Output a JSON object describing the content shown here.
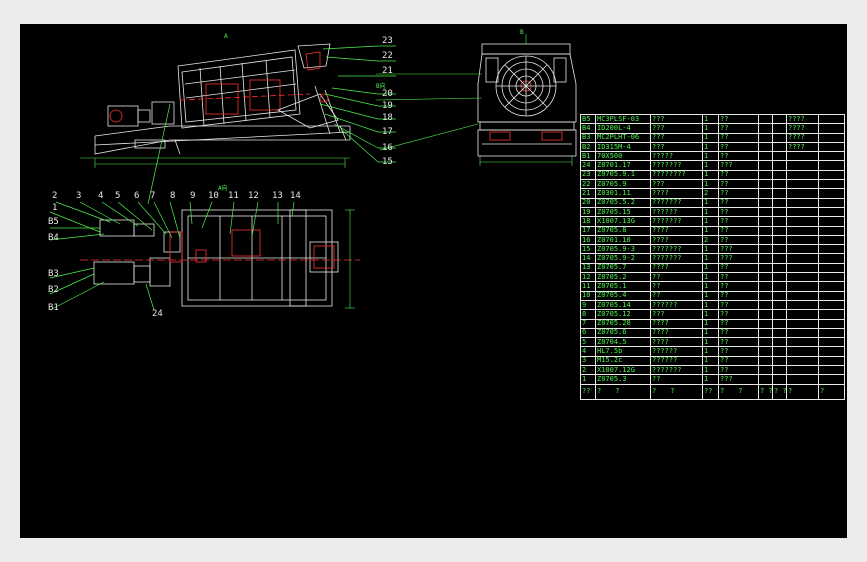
{
  "drawing": {
    "side_view_labels": [
      "23",
      "22",
      "21",
      "20",
      "19",
      "18",
      "17",
      "16",
      "15"
    ],
    "top_view_labels": [
      "2",
      "3",
      "4",
      "5",
      "6",
      "7",
      "8",
      "9",
      "10",
      "11",
      "12",
      "13",
      "14"
    ],
    "left_labels": [
      "1",
      "B5",
      "B4",
      "B3",
      "B2",
      "B1"
    ],
    "bottom_label": "24",
    "section_marks": {
      "a": "A",
      "b": "B",
      "ab": "A向",
      "b_arrow": "B向"
    }
  },
  "bom": {
    "rows": [
      [
        "B5",
        "MC3PLSF-03",
        "???",
        "1",
        "??",
        "",
        "",
        "????",
        ""
      ],
      [
        "B4",
        "ID200L-4",
        "???",
        "1",
        "??",
        "",
        "",
        "????",
        ""
      ],
      [
        "B3",
        "MC2PLHT-06",
        "???",
        "1",
        "??",
        "",
        "",
        "????",
        ""
      ],
      [
        "B2",
        "ID315M-4",
        "???",
        "1",
        "??",
        "",
        "",
        "????",
        ""
      ],
      [
        "B1",
        "70X500",
        "?????",
        "1",
        "??",
        "",
        "",
        "",
        ""
      ],
      [
        "24",
        "Z0701.17",
        "???????",
        "1",
        "???",
        "",
        "",
        "",
        ""
      ],
      [
        "23",
        "Z0705.9.1",
        "????????",
        "1",
        "??",
        "",
        "",
        "",
        ""
      ],
      [
        "22",
        "Z0705.9",
        "???",
        "1",
        "??",
        "",
        "",
        "",
        ""
      ],
      [
        "21",
        "Z0301.11",
        "????",
        "2",
        "??",
        "",
        "",
        "",
        ""
      ],
      [
        "20",
        "Z0705.5.2",
        "???????",
        "1",
        "??",
        "",
        "",
        "",
        ""
      ],
      [
        "19",
        "Z0705.15",
        "??????",
        "1",
        "??",
        "",
        "",
        "",
        ""
      ],
      [
        "18",
        "X1007.13G",
        "???????",
        "1",
        "??",
        "",
        "",
        "",
        ""
      ],
      [
        "17",
        "Z0705.8",
        "????",
        "1",
        "??",
        "",
        "",
        "",
        ""
      ],
      [
        "16",
        "Z0701.10",
        "????",
        "2",
        "??",
        "",
        "",
        "",
        ""
      ],
      [
        "15",
        "Z0705.9-3",
        "???????",
        "1",
        "???",
        "",
        "",
        "",
        ""
      ],
      [
        "14",
        "Z0705.9-2",
        "???????",
        "1",
        "???",
        "",
        "",
        "",
        ""
      ],
      [
        "13",
        "Z0705.7",
        "????",
        "1",
        "??",
        "",
        "",
        "",
        ""
      ],
      [
        "12",
        "Z0705.2",
        "??",
        "1",
        "??",
        "",
        "",
        "",
        ""
      ],
      [
        "11",
        "Z0705.1",
        "??",
        "1",
        "??",
        "",
        "",
        "",
        ""
      ],
      [
        "10",
        "Z0705.4",
        "??",
        "1",
        "??",
        "",
        "",
        "",
        ""
      ],
      [
        "9",
        "Z0705.14",
        "??????",
        "1",
        "??",
        "",
        "",
        "",
        ""
      ],
      [
        "8",
        "Z0705.12",
        "???",
        "1",
        "??",
        "",
        "",
        "",
        ""
      ],
      [
        "7",
        "Z0705.20",
        "????",
        "1",
        "??",
        "",
        "",
        "",
        ""
      ],
      [
        "6",
        "Z0705.6",
        "????",
        "1",
        "??",
        "",
        "",
        "",
        ""
      ],
      [
        "5",
        "Z0704.5",
        "????",
        "1",
        "??",
        "",
        "",
        "",
        ""
      ],
      [
        "4",
        "HL7.5b",
        "??????",
        "1",
        "??",
        "",
        "",
        "",
        ""
      ],
      [
        "3",
        "M15.2c",
        "??????",
        "1",
        "??",
        "",
        "",
        "",
        ""
      ],
      [
        "2",
        "X1007.12G",
        "???????",
        "1",
        "??",
        "",
        "",
        "",
        ""
      ],
      [
        "1",
        "Z0705.3",
        "??",
        "1",
        "???",
        "",
        "",
        "",
        ""
      ]
    ],
    "header": [
      "??",
      "?",
      "?",
      "?",
      "?",
      "??",
      "?",
      "?",
      "? ?",
      "? ? ?",
      "?",
      "?"
    ]
  }
}
